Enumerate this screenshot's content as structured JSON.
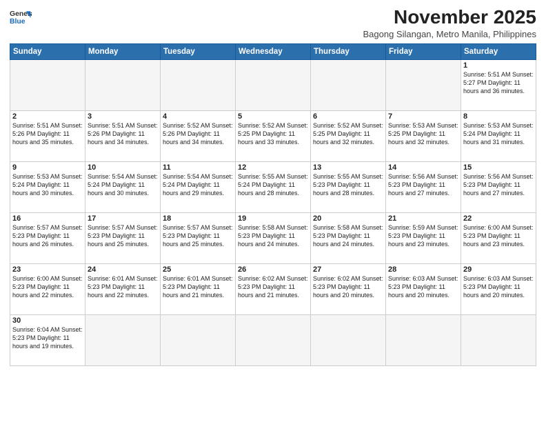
{
  "header": {
    "logo_general": "General",
    "logo_blue": "Blue",
    "title": "November 2025",
    "subtitle": "Bagong Silangan, Metro Manila, Philippines"
  },
  "days_of_week": [
    "Sunday",
    "Monday",
    "Tuesday",
    "Wednesday",
    "Thursday",
    "Friday",
    "Saturday"
  ],
  "weeks": [
    [
      {
        "day": "",
        "info": ""
      },
      {
        "day": "",
        "info": ""
      },
      {
        "day": "",
        "info": ""
      },
      {
        "day": "",
        "info": ""
      },
      {
        "day": "",
        "info": ""
      },
      {
        "day": "",
        "info": ""
      },
      {
        "day": "1",
        "info": "Sunrise: 5:51 AM\nSunset: 5:27 PM\nDaylight: 11 hours\nand 36 minutes."
      }
    ],
    [
      {
        "day": "2",
        "info": "Sunrise: 5:51 AM\nSunset: 5:26 PM\nDaylight: 11 hours\nand 35 minutes."
      },
      {
        "day": "3",
        "info": "Sunrise: 5:51 AM\nSunset: 5:26 PM\nDaylight: 11 hours\nand 34 minutes."
      },
      {
        "day": "4",
        "info": "Sunrise: 5:52 AM\nSunset: 5:26 PM\nDaylight: 11 hours\nand 34 minutes."
      },
      {
        "day": "5",
        "info": "Sunrise: 5:52 AM\nSunset: 5:25 PM\nDaylight: 11 hours\nand 33 minutes."
      },
      {
        "day": "6",
        "info": "Sunrise: 5:52 AM\nSunset: 5:25 PM\nDaylight: 11 hours\nand 32 minutes."
      },
      {
        "day": "7",
        "info": "Sunrise: 5:53 AM\nSunset: 5:25 PM\nDaylight: 11 hours\nand 32 minutes."
      },
      {
        "day": "8",
        "info": "Sunrise: 5:53 AM\nSunset: 5:24 PM\nDaylight: 11 hours\nand 31 minutes."
      }
    ],
    [
      {
        "day": "9",
        "info": "Sunrise: 5:53 AM\nSunset: 5:24 PM\nDaylight: 11 hours\nand 30 minutes."
      },
      {
        "day": "10",
        "info": "Sunrise: 5:54 AM\nSunset: 5:24 PM\nDaylight: 11 hours\nand 30 minutes."
      },
      {
        "day": "11",
        "info": "Sunrise: 5:54 AM\nSunset: 5:24 PM\nDaylight: 11 hours\nand 29 minutes."
      },
      {
        "day": "12",
        "info": "Sunrise: 5:55 AM\nSunset: 5:24 PM\nDaylight: 11 hours\nand 28 minutes."
      },
      {
        "day": "13",
        "info": "Sunrise: 5:55 AM\nSunset: 5:23 PM\nDaylight: 11 hours\nand 28 minutes."
      },
      {
        "day": "14",
        "info": "Sunrise: 5:56 AM\nSunset: 5:23 PM\nDaylight: 11 hours\nand 27 minutes."
      },
      {
        "day": "15",
        "info": "Sunrise: 5:56 AM\nSunset: 5:23 PM\nDaylight: 11 hours\nand 27 minutes."
      }
    ],
    [
      {
        "day": "16",
        "info": "Sunrise: 5:57 AM\nSunset: 5:23 PM\nDaylight: 11 hours\nand 26 minutes."
      },
      {
        "day": "17",
        "info": "Sunrise: 5:57 AM\nSunset: 5:23 PM\nDaylight: 11 hours\nand 25 minutes."
      },
      {
        "day": "18",
        "info": "Sunrise: 5:57 AM\nSunset: 5:23 PM\nDaylight: 11 hours\nand 25 minutes."
      },
      {
        "day": "19",
        "info": "Sunrise: 5:58 AM\nSunset: 5:23 PM\nDaylight: 11 hours\nand 24 minutes."
      },
      {
        "day": "20",
        "info": "Sunrise: 5:58 AM\nSunset: 5:23 PM\nDaylight: 11 hours\nand 24 minutes."
      },
      {
        "day": "21",
        "info": "Sunrise: 5:59 AM\nSunset: 5:23 PM\nDaylight: 11 hours\nand 23 minutes."
      },
      {
        "day": "22",
        "info": "Sunrise: 6:00 AM\nSunset: 5:23 PM\nDaylight: 11 hours\nand 23 minutes."
      }
    ],
    [
      {
        "day": "23",
        "info": "Sunrise: 6:00 AM\nSunset: 5:23 PM\nDaylight: 11 hours\nand 22 minutes."
      },
      {
        "day": "24",
        "info": "Sunrise: 6:01 AM\nSunset: 5:23 PM\nDaylight: 11 hours\nand 22 minutes."
      },
      {
        "day": "25",
        "info": "Sunrise: 6:01 AM\nSunset: 5:23 PM\nDaylight: 11 hours\nand 21 minutes."
      },
      {
        "day": "26",
        "info": "Sunrise: 6:02 AM\nSunset: 5:23 PM\nDaylight: 11 hours\nand 21 minutes."
      },
      {
        "day": "27",
        "info": "Sunrise: 6:02 AM\nSunset: 5:23 PM\nDaylight: 11 hours\nand 20 minutes."
      },
      {
        "day": "28",
        "info": "Sunrise: 6:03 AM\nSunset: 5:23 PM\nDaylight: 11 hours\nand 20 minutes."
      },
      {
        "day": "29",
        "info": "Sunrise: 6:03 AM\nSunset: 5:23 PM\nDaylight: 11 hours\nand 20 minutes."
      }
    ],
    [
      {
        "day": "30",
        "info": "Sunrise: 6:04 AM\nSunset: 5:23 PM\nDaylight: 11 hours\nand 19 minutes."
      },
      {
        "day": "",
        "info": ""
      },
      {
        "day": "",
        "info": ""
      },
      {
        "day": "",
        "info": ""
      },
      {
        "day": "",
        "info": ""
      },
      {
        "day": "",
        "info": ""
      },
      {
        "day": "",
        "info": ""
      }
    ]
  ]
}
